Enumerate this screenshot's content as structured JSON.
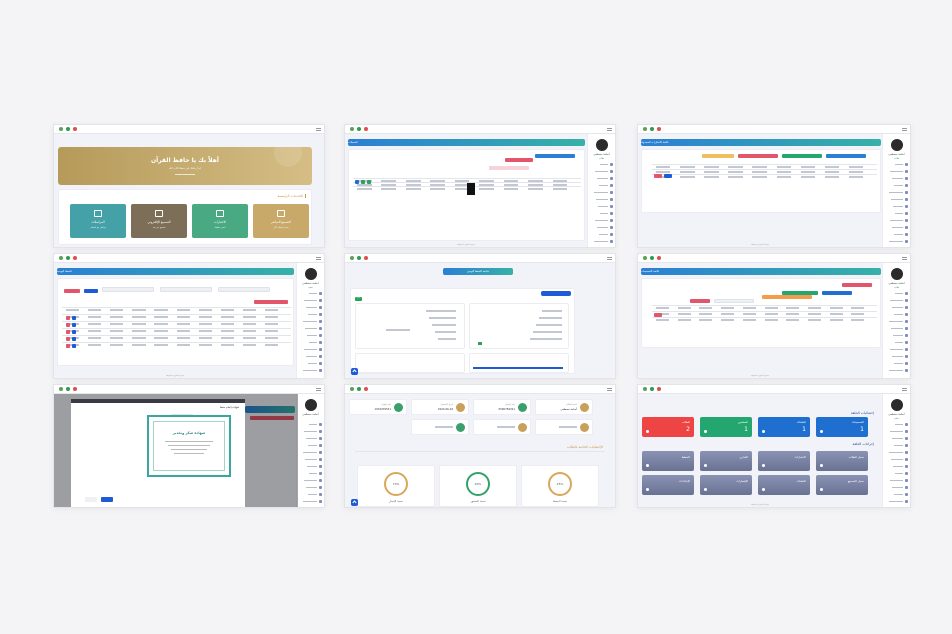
{
  "panel1": {
    "banner_title": "أهلاً بك يا حافظ القرآن",
    "banner_subtitle": "ابدأ رحلتك في حفظ كتاب الله",
    "section_title": "الخدمات الرئيسية",
    "tiles": [
      {
        "label": "التسميع المباشر",
        "desc": "سجل تلاوتك الآن",
        "color": "#c8a96a",
        "icon": "mic-icon"
      },
      {
        "label": "الاختبارات",
        "desc": "اختبر حفظك",
        "color": "#48a982",
        "icon": "clipboard-icon"
      },
      {
        "label": "التسميع الإلكتروني",
        "desc": "تسميع عن بعد",
        "color": "#7d6e57",
        "icon": "monitor-icon"
      },
      {
        "label": "المراسلات",
        "desc": "تواصل مع المعلم",
        "color": "#45a1a8",
        "icon": "mail-icon"
      }
    ]
  },
  "panel2": {
    "header": "السجلات",
    "user_name": "أسامة مصطفى",
    "user_role": "طالب"
  },
  "panel3": {
    "header": "قائمة الاختبارات المجدولة",
    "user_name": "أسامة مصطفى",
    "user_role": "طالب"
  },
  "panel4": {
    "header": "الخطة اليومية",
    "user_name": "أسامة مصطفى",
    "user_role": "معلم"
  },
  "panel5": {
    "header": "متابعة الحفظ اليومي",
    "tag": "جديد",
    "user_role": "طالب"
  },
  "panel6": {
    "header": "قائمة التسميعات",
    "user_name": "أسامة مصطفى",
    "user_role": "طالب"
  },
  "panel7": {
    "dialog_title": "شهادة إتمام حفظ",
    "certificate_title": "شهادة شكر وتقدير",
    "submit_label": "حفظ",
    "cancel_label": "إلغاء",
    "user_name": "أسامة مصطفى"
  },
  "panel8": {
    "info": [
      {
        "label": "اسم الطالب",
        "value": "أسامة مصطفى"
      },
      {
        "label": "رقم الجوال",
        "value": "0596784321"
      },
      {
        "label": "تاريخ التسجيل",
        "value": "2024-06-04"
      },
      {
        "label": "رقم الهوية",
        "value": "1034976541"
      }
    ],
    "section_title": "الإحصائيات الخاصة بالطالب",
    "stats": [
      {
        "label": "نسبة الحفظ",
        "value": "45%",
        "color": "#d9a65d"
      },
      {
        "label": "نسبة الحضور",
        "value": "90%",
        "color": "#34a16b"
      },
      {
        "label": "نسبة الإنجاز",
        "value": "70%",
        "color": "#d9a65d"
      }
    ]
  },
  "panel9": {
    "section1": "إحصائيات الحلقة",
    "section2": "إجراءات الحلقة",
    "user_name": "أسامة مصطفى",
    "user_role": "معلم",
    "stat_cards": [
      {
        "label": "الطلاب",
        "value": "2",
        "color": "#ef4444"
      },
      {
        "label": "المعلمين",
        "value": "1",
        "color": "#23a670"
      },
      {
        "label": "الحلقات",
        "value": "1",
        "color": "#1f6fd1"
      },
      {
        "label": "التسميعات",
        "value": "1",
        "color": "#1f6fd1"
      }
    ],
    "actions": [
      "سجل الطلاب",
      "الاختبارات",
      "التقارير",
      "الخطط",
      "سجل التسميع",
      "الحلقات",
      "الإشعارات",
      "الإعدادات"
    ]
  },
  "footer": "جميع الحقوق محفوظة"
}
